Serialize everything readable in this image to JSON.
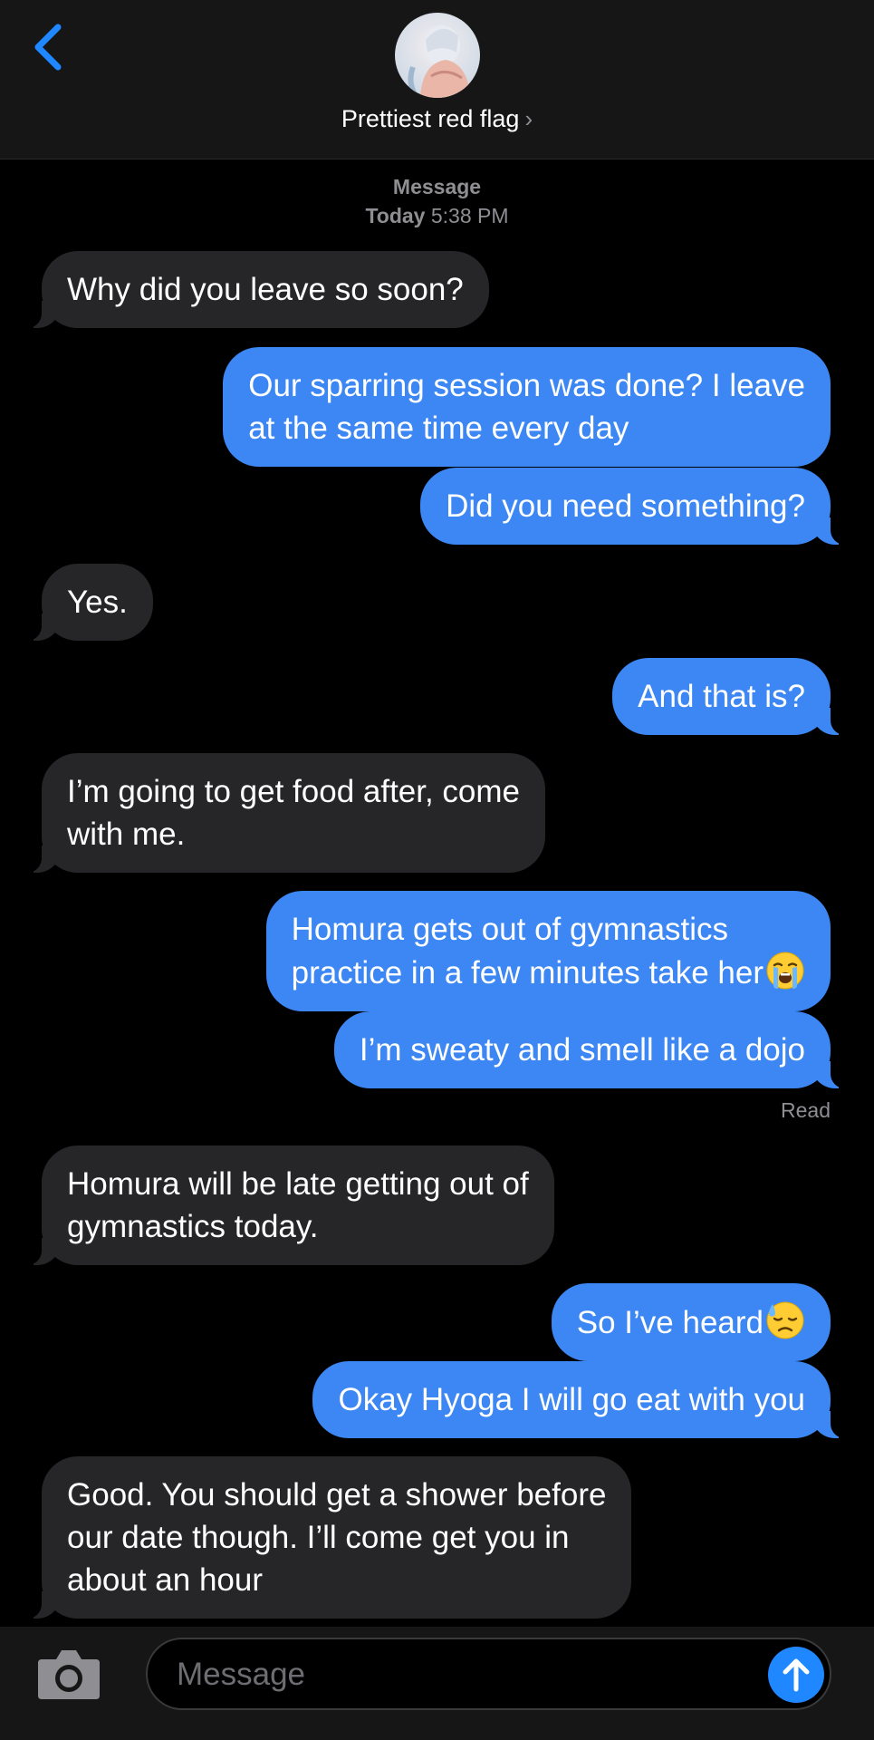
{
  "header": {
    "contact_name": "Prettiest red flag",
    "chevron": "›"
  },
  "timestamp": {
    "service": "Message",
    "day": "Today",
    "time": "5:38 PM"
  },
  "messages": [
    {
      "from": "them",
      "text": "Why did you leave so soon?"
    },
    {
      "from": "me",
      "lines": [
        "Our sparring session was done? I leave",
        "at the same time every day"
      ]
    },
    {
      "from": "me",
      "text": "Did you need something?"
    },
    {
      "from": "them",
      "text": "Yes."
    },
    {
      "from": "me",
      "text": "And that is?"
    },
    {
      "from": "them",
      "lines": [
        "I’m going to get food after, come",
        "with me."
      ]
    },
    {
      "from": "me",
      "lines": [
        "Homura gets out of gymnastics",
        "practice in a few minutes take her"
      ],
      "emoji": "loudly-crying-face"
    },
    {
      "from": "me",
      "text": "I’m sweaty and smell like a dojo"
    },
    {
      "from": "them",
      "lines": [
        "Homura will be late getting out of",
        "gymnastics today."
      ]
    },
    {
      "from": "me",
      "text": "So I’ve heard",
      "emoji": "downcast-face-with-sweat"
    },
    {
      "from": "me",
      "text": "Okay Hyoga I will go eat with you"
    },
    {
      "from": "them",
      "lines": [
        "Good. You should get a shower before",
        "our date though. I’ll come get you in",
        "about an hour"
      ]
    }
  ],
  "read_receipt": "Read",
  "input": {
    "placeholder": "Message"
  },
  "colors": {
    "outgoing_bubble": "#3c87f3",
    "incoming_bubble": "#262629",
    "accent": "#1f87ff",
    "background": "#000000"
  },
  "icons": [
    "back-chevron-icon",
    "camera-icon",
    "send-arrow-icon",
    "loudly-crying-face-emoji",
    "downcast-face-with-sweat-emoji"
  ]
}
